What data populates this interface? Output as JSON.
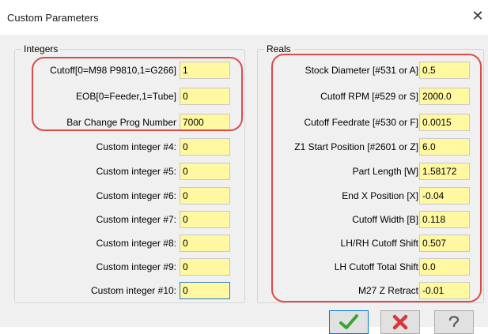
{
  "window": {
    "title": "Custom Parameters",
    "close_glyph": "✕"
  },
  "integers": {
    "title": "Integers",
    "fields": [
      {
        "label": "Cutoff[0=M98 P9810,1=G266]",
        "value": "1"
      },
      {
        "label": "EOB[0=Feeder,1=Tube]",
        "value": "0"
      },
      {
        "label": "Bar Change Prog Number",
        "value": "7000"
      },
      {
        "label": "Custom integer #4:",
        "value": "0"
      },
      {
        "label": "Custom integer #5:",
        "value": "0"
      },
      {
        "label": "Custom integer #6:",
        "value": "0"
      },
      {
        "label": "Custom integer #7:",
        "value": "0"
      },
      {
        "label": "Custom integer #8:",
        "value": "0"
      },
      {
        "label": "Custom integer #9:",
        "value": "0"
      },
      {
        "label": "Custom integer #10:",
        "value": "0"
      }
    ]
  },
  "reals": {
    "title": "Reals",
    "fields": [
      {
        "label": "Stock Diameter [#531 or A]",
        "value": "0.5"
      },
      {
        "label": "Cutoff RPM [#529 or S]",
        "value": "2000.0"
      },
      {
        "label": "Cutoff Feedrate [#530 or F]",
        "value": "0.0015"
      },
      {
        "label": "Z1 Start Position [#2601 or Z]",
        "value": "6.0"
      },
      {
        "label": "Part Length [W]",
        "value": "1.58172"
      },
      {
        "label": "End X Position [X]",
        "value": "-0.04"
      },
      {
        "label": "Cutoff Width [B]",
        "value": "0.118"
      },
      {
        "label": "LH/RH Cutoff Shift",
        "value": "0.507"
      },
      {
        "label": "LH Cutoff Total Shift",
        "value": "0.0"
      },
      {
        "label": "M27 Z Retract",
        "value": "-0.01"
      }
    ]
  },
  "buttons": [
    {
      "name": "ok-button",
      "icon": "checkmark-icon"
    },
    {
      "name": "cancel-button",
      "icon": "x-icon"
    },
    {
      "name": "help-button",
      "icon": "question-icon"
    }
  ],
  "colors": {
    "field_bg": "#fff8a0",
    "highlight": "#de4a4a",
    "focus_border": "#2e7ad1",
    "check_green": "#3aa335",
    "cancel_red": "#d9363e"
  }
}
